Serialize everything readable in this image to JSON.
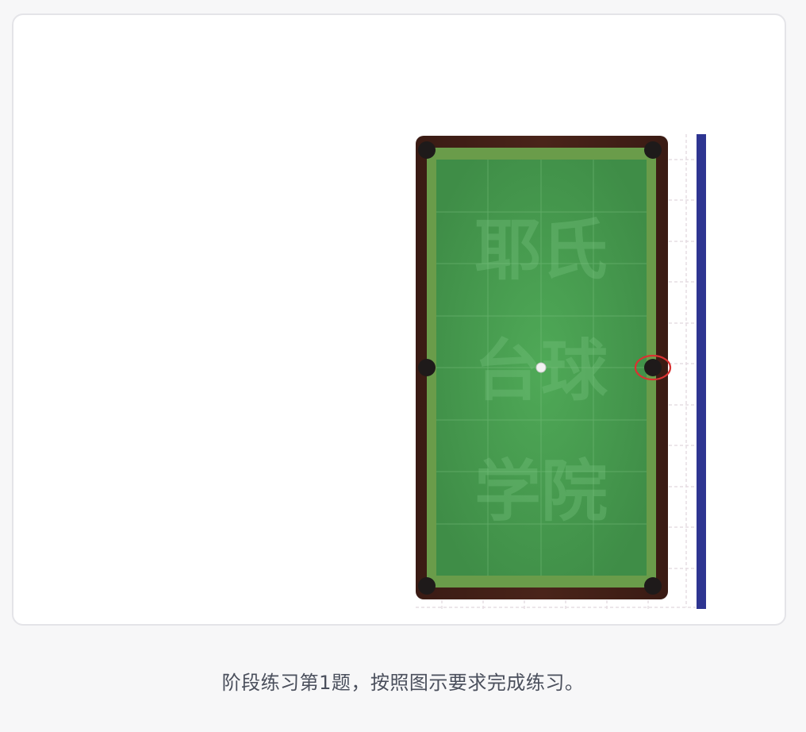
{
  "table": {
    "watermark": [
      "耶氏",
      "台球",
      "学院"
    ],
    "rail_color": "#3f1f17",
    "cushion_color": "#5f9a45",
    "felt_color": "#4a9e52",
    "pocket_color": "#1e1a1a",
    "target_marker_color": "#d93232",
    "side_bar_color": "#2e3591"
  },
  "caption": "阶段练习第1题，按照图示要求完成练习。"
}
